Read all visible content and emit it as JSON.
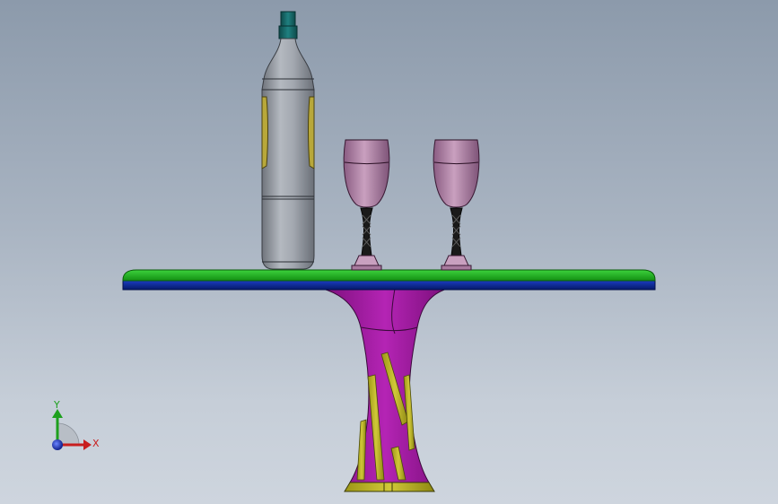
{
  "viewport": {
    "background_top": "#8c9aab",
    "background_bottom": "#ced5de"
  },
  "model": {
    "parts": [
      {
        "name": "bottle",
        "color": "#9aa0a8",
        "cap_color": "#1a6e6e",
        "label_color": "#b8a83a"
      },
      {
        "name": "wine-glass-left",
        "color": "#a87a9e",
        "stem_color": "#1a1a1a"
      },
      {
        "name": "wine-glass-right",
        "color": "#a87a9e",
        "stem_color": "#1a1a1a"
      },
      {
        "name": "tabletop",
        "top_color": "#22a822",
        "edge_color": "#0a2a8c"
      },
      {
        "name": "table-pedestal",
        "color": "#a020a0",
        "accent_color": "#b8b020"
      }
    ]
  },
  "triad": {
    "x_label": "X",
    "y_label": "Y",
    "x_color": "#c81e1e",
    "y_color": "#1ea01e",
    "z_color": "#1e3cc8"
  }
}
